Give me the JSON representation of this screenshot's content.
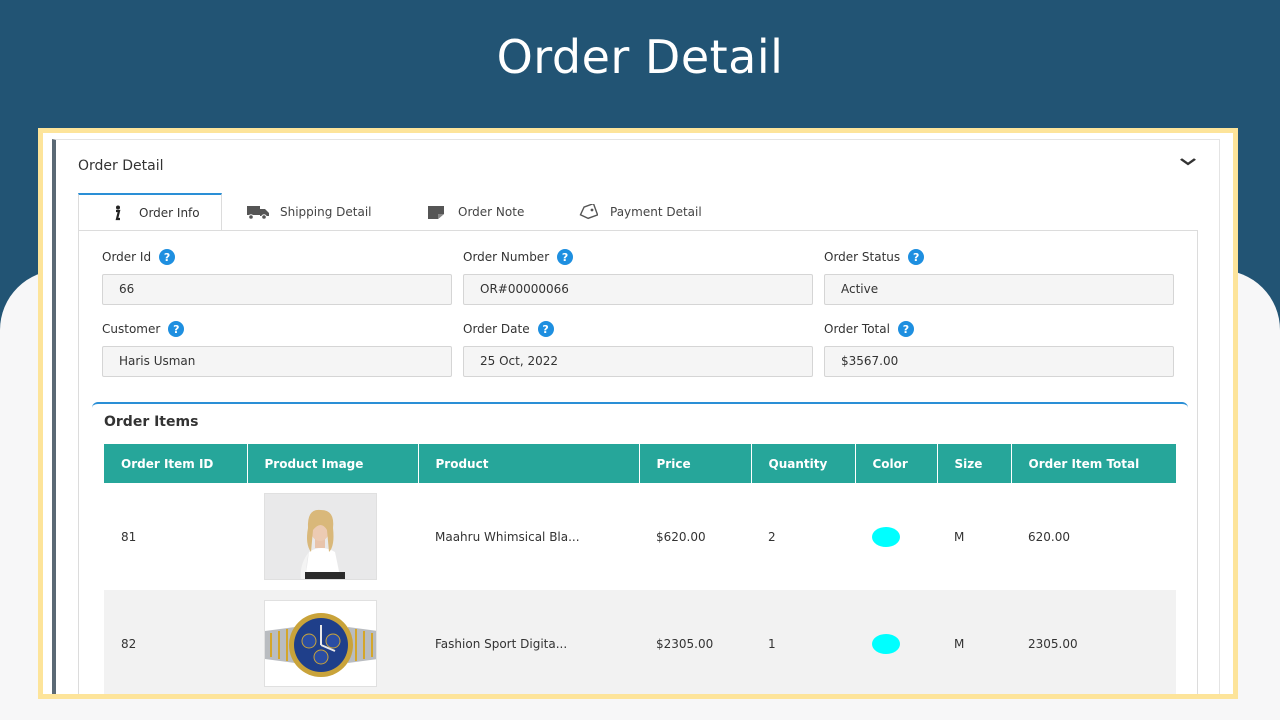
{
  "slide": {
    "title": "Order Detail"
  },
  "panel": {
    "header": "Order Detail"
  },
  "tabs": [
    {
      "label": "Order Info",
      "icon": "info-icon"
    },
    {
      "label": "Shipping Detail",
      "icon": "truck-icon"
    },
    {
      "label": "Order Note",
      "icon": "note-icon"
    },
    {
      "label": "Payment Detail",
      "icon": "tag-icon"
    }
  ],
  "fields": {
    "order_id": {
      "label": "Order Id",
      "value": "66"
    },
    "order_number": {
      "label": "Order Number",
      "value": "OR#00000066"
    },
    "order_status": {
      "label": "Order Status",
      "value": "Active"
    },
    "customer": {
      "label": "Customer",
      "value": "Haris Usman"
    },
    "order_date": {
      "label": "Order Date",
      "value": "25 Oct, 2022"
    },
    "order_total": {
      "label": "Order Total",
      "value": "$3567.00"
    }
  },
  "order_items": {
    "title": "Order Items",
    "columns": [
      "Order Item ID",
      "Product Image",
      "Product",
      "Price",
      "Quantity",
      "Color",
      "Size",
      "Order Item Total"
    ],
    "rows": [
      {
        "id": "81",
        "image": "woman-photo",
        "product": "Maahru Whimsical Bla...",
        "price": "$620.00",
        "quantity": "2",
        "color": "#00ffff",
        "size": "M",
        "total": "620.00"
      },
      {
        "id": "82",
        "image": "watch-photo",
        "product": "Fashion Sport Digita...",
        "price": "$2305.00",
        "quantity": "1",
        "color": "#00ffff",
        "size": "M",
        "total": "2305.00"
      }
    ]
  },
  "colors": {
    "header_bg": "#225474",
    "table_header": "#26a69a",
    "accent": "#2a8fd6",
    "frame": "#fde49a"
  }
}
